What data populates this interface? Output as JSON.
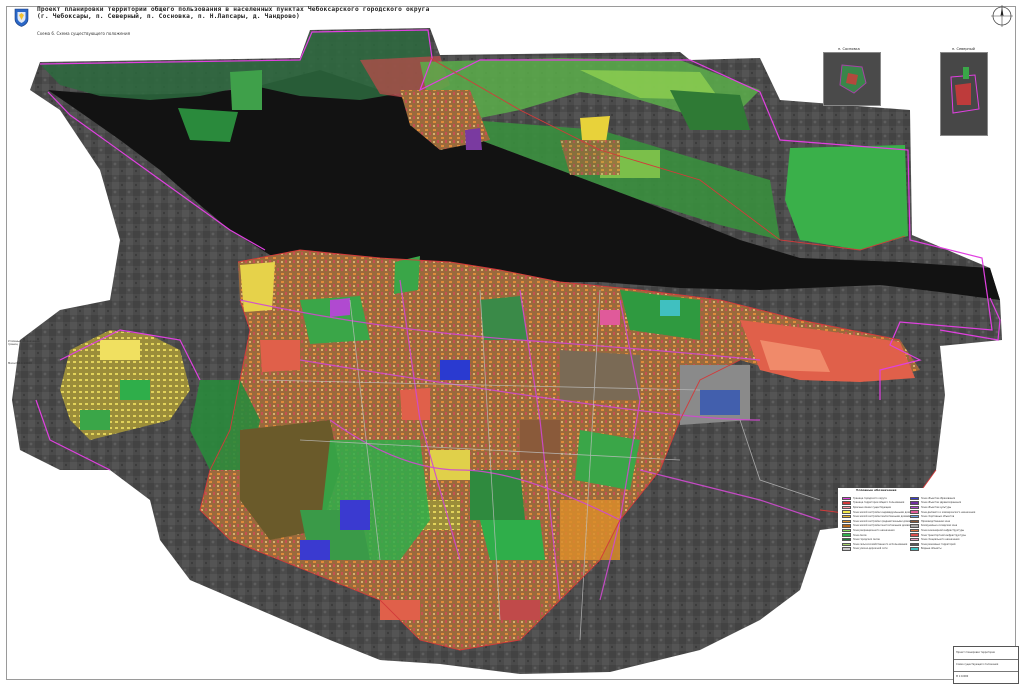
{
  "header": {
    "title_line1": "Проект планировки территории общего пользования в населенных пунктах Чебоксарского городского округа",
    "title_line2": "(г. Чебоксары, п. Северный, п. Сосновка, п. Н.Лапсары, д. Чандрово)",
    "subtitle": "Схема 6. Схема существующего положения"
  },
  "icons": {
    "emblem": "coat-of-arms-icon",
    "compass": "north-arrow-icon"
  },
  "insets": [
    {
      "label": "п. Сосновка"
    },
    {
      "label": "п. Северный"
    }
  ],
  "side_notes": [
    {
      "text": "Условные обозначения границ"
    },
    {
      "text": "Масштаб 1:10000"
    }
  ],
  "legend": {
    "title": "Условные обозначения",
    "left_items": [
      {
        "color": "#e040e0",
        "label": "Граница городского округа"
      },
      {
        "color": "#d33a3a",
        "label": "Граница территории общего пользования"
      },
      {
        "color": "#ff9aa8",
        "label": "Красные линии существующие"
      },
      {
        "color": "#f4e94a",
        "label": "Зона жилой застройки индивидуальными домами"
      },
      {
        "color": "#e8b430",
        "label": "Зона жилой застройки малоэтажными домами"
      },
      {
        "color": "#d98c2a",
        "label": "Зона жилой застройки среднеэтажными домами"
      },
      {
        "color": "#b76a1f",
        "label": "Зона жилой застройки многоэтажными домами"
      },
      {
        "color": "#7ed957",
        "label": "Зона рекреационного назначения"
      },
      {
        "color": "#2fae4a",
        "label": "Зона лесов"
      },
      {
        "color": "#1f7a3a",
        "label": "Зона городских лесов"
      },
      {
        "color": "#a7d36d",
        "label": "Зона сельскохозяйственного использования"
      },
      {
        "color": "#c8c8c8",
        "label": "Зона улично-дорожной сети"
      }
    ],
    "right_items": [
      {
        "color": "#3a3ad0",
        "label": "Зона объектов образования"
      },
      {
        "color": "#7030a0",
        "label": "Зона объектов здравоохранения"
      },
      {
        "color": "#b04ad0",
        "label": "Зона объектов культуры"
      },
      {
        "color": "#e05a9a",
        "label": "Зона делового и коммерческого назначения"
      },
      {
        "color": "#6aa0e0",
        "label": "Зона спортивных объектов"
      },
      {
        "color": "#8a5a3a",
        "label": "Производственная зона"
      },
      {
        "color": "#a8a8a8",
        "label": "Коммунально-складская зона"
      },
      {
        "color": "#e07840",
        "label": "Зона инженерной инфраструктуры"
      },
      {
        "color": "#d95050",
        "label": "Зона транспортной инфраструктуры"
      },
      {
        "color": "#e8a0c0",
        "label": "Зона специального назначения"
      },
      {
        "color": "#5a5a5a",
        "label": "Зона режимных территорий"
      },
      {
        "color": "#40c0c0",
        "label": "Водные объекты"
      }
    ]
  },
  "stamp": {
    "org": "Проект планировки территории",
    "sheet": "Схема существующего положения",
    "scale": "М 1:10000"
  },
  "colors": {
    "boundary": "#e040e0",
    "forest": "#2fae4a",
    "water": "#141414",
    "residential": "#d98c2a"
  }
}
